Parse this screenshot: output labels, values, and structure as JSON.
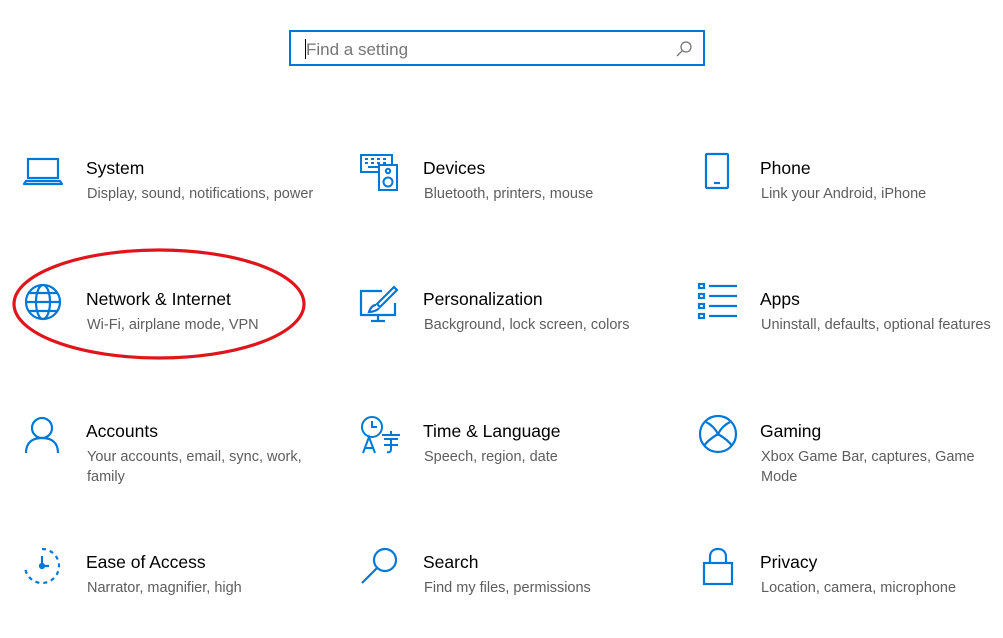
{
  "search": {
    "placeholder": "Find a setting",
    "icon": "search-icon"
  },
  "accent_color": "#0078d7",
  "annotation_color": "#e0151b",
  "tiles": [
    {
      "id": "system",
      "title": "System",
      "desc": "Display, sound, notifications, power",
      "icon": "laptop-icon"
    },
    {
      "id": "devices",
      "title": "Devices",
      "desc": "Bluetooth, printers, mouse",
      "icon": "keyboard-speaker-icon"
    },
    {
      "id": "phone",
      "title": "Phone",
      "desc": "Link your Android, iPhone",
      "icon": "phone-icon"
    },
    {
      "id": "network",
      "title": "Network & Internet",
      "desc": "Wi-Fi, airplane mode, VPN",
      "icon": "globe-icon",
      "highlighted": true
    },
    {
      "id": "personalization",
      "title": "Personalization",
      "desc": "Background, lock screen, colors",
      "icon": "paintbrush-monitor-icon"
    },
    {
      "id": "apps",
      "title": "Apps",
      "desc": "Uninstall, defaults, optional features",
      "icon": "apps-list-icon"
    },
    {
      "id": "accounts",
      "title": "Accounts",
      "desc": "Your accounts, email, sync, work, family",
      "icon": "person-icon"
    },
    {
      "id": "time-language",
      "title": "Time & Language",
      "desc": "Speech, region, date",
      "icon": "time-language-icon"
    },
    {
      "id": "gaming",
      "title": "Gaming",
      "desc": "Xbox Game Bar, captures, Game Mode",
      "icon": "xbox-icon"
    },
    {
      "id": "ease-of-access",
      "title": "Ease of Access",
      "desc": "Narrator, magnifier, high",
      "icon": "ease-of-access-icon"
    },
    {
      "id": "search",
      "title": "Search",
      "desc": "Find my files, permissions",
      "icon": "magnifier-icon"
    },
    {
      "id": "privacy",
      "title": "Privacy",
      "desc": "Location, camera, microphone",
      "icon": "lock-icon"
    }
  ]
}
